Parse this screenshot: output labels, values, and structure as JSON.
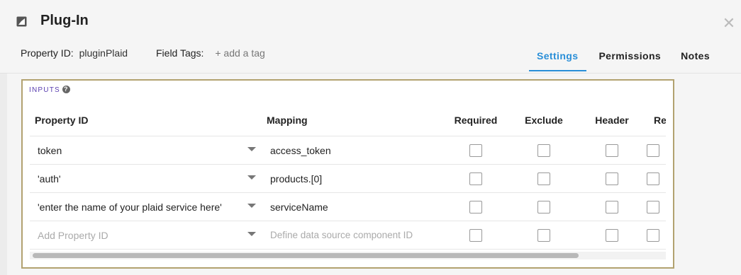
{
  "header": {
    "title": "Plug-In",
    "property_id_label": "Property ID:",
    "property_id_value": "pluginPlaid",
    "field_tags_label": "Field Tags:",
    "add_tag": "+ add a tag"
  },
  "tabs": [
    {
      "label": "Settings",
      "active": true
    },
    {
      "label": "Permissions",
      "active": false
    },
    {
      "label": "Notes",
      "active": false
    }
  ],
  "inputs": {
    "label": "INPUTS",
    "columns": [
      "Property ID",
      "Mapping",
      "Required",
      "Exclude",
      "Header",
      "Resolve"
    ],
    "rows": [
      {
        "property_id": "token",
        "mapping": "access_token"
      },
      {
        "property_id": "'auth'",
        "mapping": "products.[0]"
      },
      {
        "property_id": "'enter the name of your plaid service here'",
        "mapping": "serviceName"
      },
      {
        "property_id_placeholder": "Add Property ID",
        "mapping_placeholder": "Define data source component ID"
      }
    ]
  },
  "icons": {
    "title": "image-icon",
    "close": "close-icon",
    "help": "help-icon",
    "dropdown": "caret-down-icon"
  },
  "colors": {
    "accent": "#2a8fd8",
    "panel_border": "#b2a270",
    "inputs_label": "#5a3fb0"
  }
}
